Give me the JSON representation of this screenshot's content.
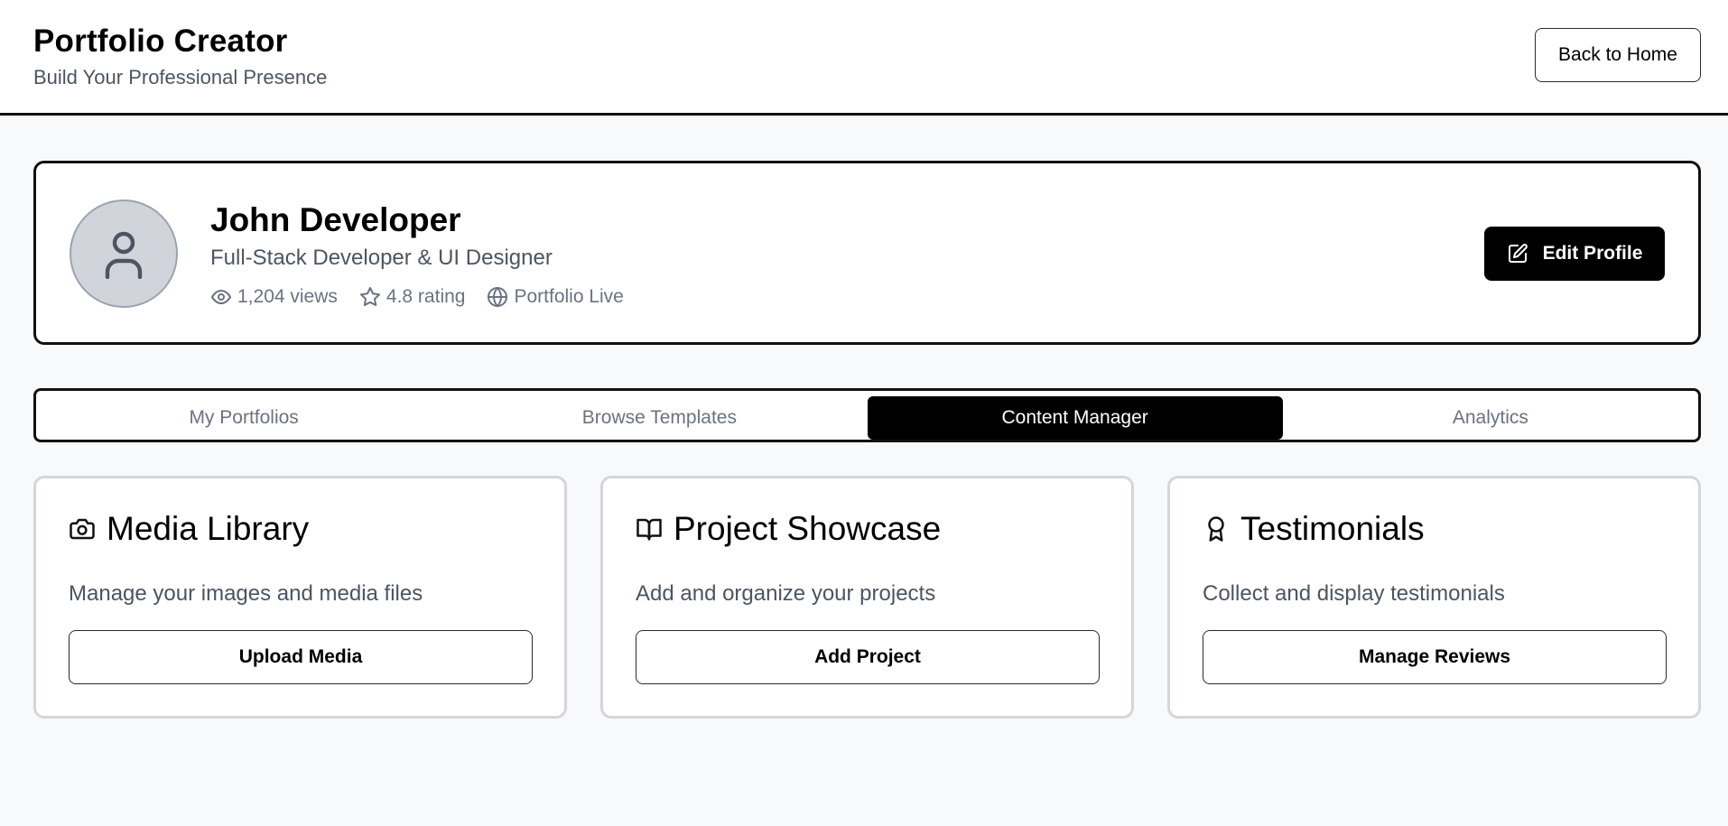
{
  "header": {
    "title": "Portfolio Creator",
    "subtitle": "Build Your Professional Presence",
    "back_label": "Back to Home"
  },
  "profile": {
    "name": "John Developer",
    "role": "Full-Stack Developer & UI Designer",
    "stats": {
      "views": "1,204 views",
      "rating": "4.8 rating",
      "status": "Portfolio Live"
    },
    "edit_label": "Edit Profile"
  },
  "tabs": [
    {
      "label": "My Portfolios",
      "active": false
    },
    {
      "label": "Browse Templates",
      "active": false
    },
    {
      "label": "Content Manager",
      "active": true
    },
    {
      "label": "Analytics",
      "active": false
    }
  ],
  "cards": [
    {
      "icon": "camera-icon",
      "title": "Media Library",
      "description": "Manage your images and media files",
      "button": "Upload Media"
    },
    {
      "icon": "book-open-icon",
      "title": "Project Showcase",
      "description": "Add and organize your projects",
      "button": "Add Project"
    },
    {
      "icon": "award-icon",
      "title": "Testimonials",
      "description": "Collect and display testimonials",
      "button": "Manage Reviews"
    }
  ],
  "colors": {
    "accent": "#000000",
    "muted_text": "#6b7280",
    "secondary_text": "#4b5563",
    "page_background": "#f8f9fb"
  }
}
